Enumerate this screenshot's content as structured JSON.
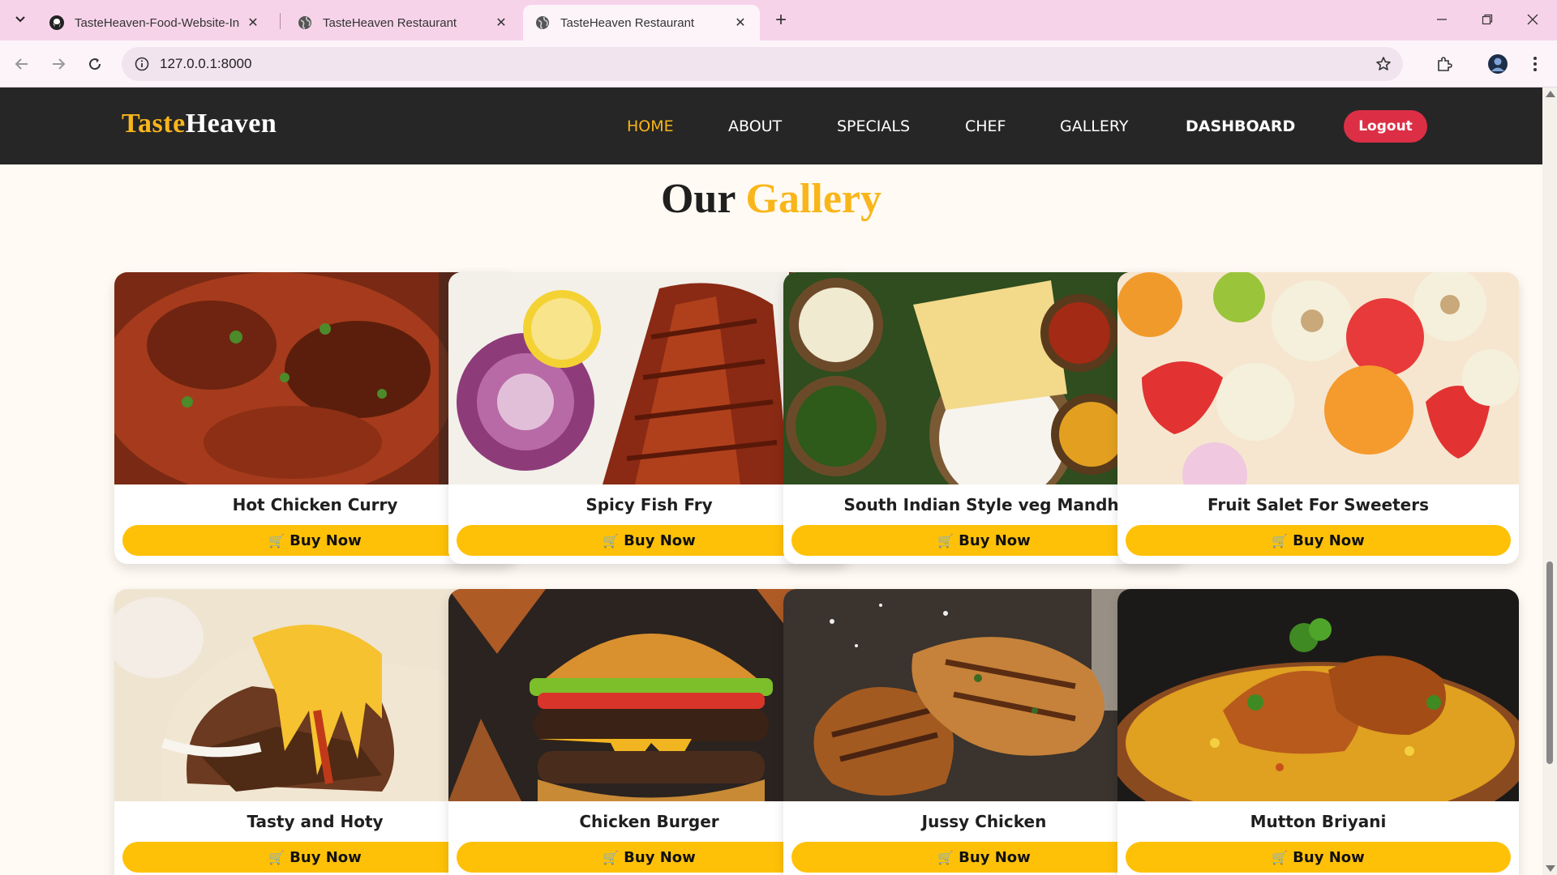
{
  "browser": {
    "tabs": [
      {
        "title": "TasteHeaven-Food-Website-In-",
        "favicon": "github-icon",
        "active": false
      },
      {
        "title": "TasteHeaven Restaurant",
        "favicon": "globe-icon",
        "active": false
      },
      {
        "title": "TasteHeaven Restaurant",
        "favicon": "globe-icon",
        "active": true
      }
    ],
    "url": "127.0.0.1:8000"
  },
  "site": {
    "logo": {
      "part1": "Taste",
      "part2": "Heaven"
    },
    "nav": [
      {
        "label": "HOME",
        "active": true
      },
      {
        "label": "ABOUT",
        "active": false
      },
      {
        "label": "SPECIALS",
        "active": false
      },
      {
        "label": "CHEF",
        "active": false
      },
      {
        "label": "GALLERY",
        "active": false
      },
      {
        "label": "DASHBOARD",
        "active": false
      }
    ],
    "logout_label": "Logout",
    "gallery": {
      "title_part1": "Our",
      "title_part2": "Gallery",
      "buy_label": "Buy Now",
      "items": [
        {
          "name": "Hot Chicken Curry"
        },
        {
          "name": "Spicy Fish Fry"
        },
        {
          "name": "South Indian Style veg Mandhi"
        },
        {
          "name": "Fruit Salet For Sweeters"
        },
        {
          "name": "Tasty and Hoty"
        },
        {
          "name": "Chicken Burger"
        },
        {
          "name": "Jussy Chicken"
        },
        {
          "name": "Mutton Briyani"
        }
      ]
    }
  },
  "colors": {
    "accent": "#f9b61a",
    "button": "#ffc107",
    "logout": "#dc2f45",
    "header_bg": "#262626",
    "page_bg": "#fffaf3"
  }
}
